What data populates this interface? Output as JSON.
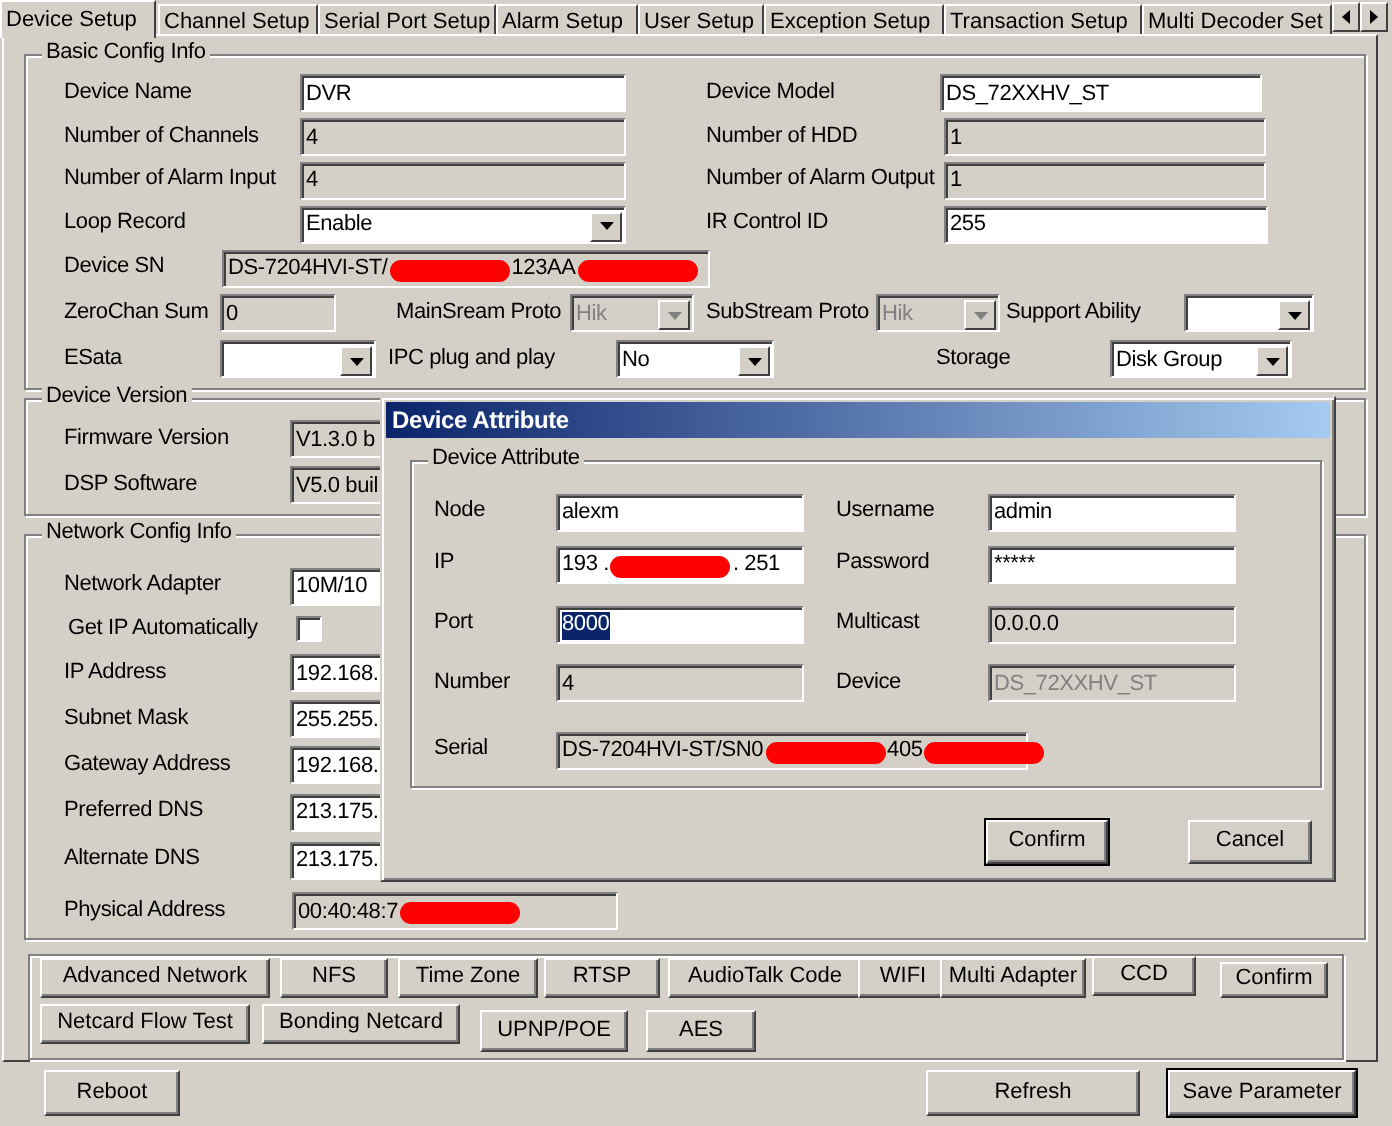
{
  "tabs": [
    {
      "label": "Device Setup",
      "selected": true
    },
    {
      "label": "Channel Setup",
      "selected": false
    },
    {
      "label": "Serial Port Setup",
      "selected": false
    },
    {
      "label": "Alarm Setup",
      "selected": false
    },
    {
      "label": "User Setup",
      "selected": false
    },
    {
      "label": "Exception Setup",
      "selected": false
    },
    {
      "label": "Transaction Setup",
      "selected": false
    },
    {
      "label": "Multi Decoder Set",
      "selected": false
    }
  ],
  "basic_config": {
    "title": "Basic Config Info",
    "fields": [
      {
        "label": "Device Name",
        "kind": "text",
        "value": "DVR"
      },
      {
        "label": "Device Model",
        "kind": "text",
        "value": "DS_72XXHV_ST"
      },
      {
        "label": "Number of Channels",
        "kind": "readonly",
        "value": "4"
      },
      {
        "label": "Number of HDD",
        "kind": "readonly",
        "value": "1"
      },
      {
        "label": "Number of Alarm Input",
        "kind": "readonly",
        "value": "4"
      },
      {
        "label": "Number of Alarm Output",
        "kind": "readonly",
        "value": "1"
      },
      {
        "label": "Loop Record",
        "kind": "select",
        "value": "Enable"
      },
      {
        "label": "IR Control ID",
        "kind": "text",
        "value": "255"
      },
      {
        "label": "Device SN",
        "kind": "readonly",
        "parts": [
          {
            "kind": "text",
            "text": "DS-7204HVI-ST/"
          },
          {
            "kind": "redaction"
          },
          {
            "kind": "text",
            "text": "123AA"
          },
          {
            "kind": "redaction"
          }
        ]
      },
      {
        "label": "ZeroChan Sum",
        "kind": "readonly",
        "value": "0"
      },
      {
        "label": "MainSream Proto",
        "kind": "select",
        "value": "Hik",
        "disabled": true
      },
      {
        "label": "SubStream Proto",
        "kind": "select",
        "value": "Hik",
        "disabled": true
      },
      {
        "label": "Support Ability",
        "kind": "select"
      },
      {
        "label": "ESata",
        "kind": "select"
      },
      {
        "label": "IPC plug and play",
        "kind": "select",
        "value": "No"
      },
      {
        "label": "Storage",
        "kind": "select",
        "value": "Disk Group"
      }
    ]
  },
  "device_version": {
    "title": "Device Version",
    "fields": [
      {
        "label": "Firmware Version",
        "kind": "readonly",
        "value": "V1.3.0 b"
      },
      {
        "label": "DSP Software",
        "kind": "readonly",
        "value": "V5.0 buil"
      }
    ]
  },
  "network_config": {
    "title": "Network Config Info",
    "fields": [
      {
        "label": "Network Adapter",
        "kind": "select",
        "value": "10M/10"
      },
      {
        "label": "Get IP Automatically",
        "kind": "checkbox",
        "checked": false
      },
      {
        "label": "IP Address",
        "kind": "text",
        "value": "192.168."
      },
      {
        "label": "Subnet Mask",
        "kind": "text",
        "value": "255.255."
      },
      {
        "label": "Gateway Address",
        "kind": "text",
        "value": "192.168."
      },
      {
        "label": "Preferred DNS",
        "kind": "text",
        "value": "213.175."
      },
      {
        "label": "Alternate DNS",
        "kind": "text",
        "value": "213.175."
      },
      {
        "label": "Physical Address",
        "kind": "readonly",
        "parts": [
          {
            "kind": "text",
            "text": "00:40:48:7"
          },
          {
            "kind": "redaction"
          }
        ]
      }
    ]
  },
  "function_buttons": [
    [
      "Advanced Network",
      "NFS",
      "Time Zone",
      "RTSP",
      "AudioTalk Code",
      "WIFI",
      "Multi Adapter",
      "CCD",
      "Confirm"
    ],
    [
      "Netcard Flow Test",
      "Bonding Netcard",
      "UPNP/POE",
      "AES"
    ]
  ],
  "bottom_buttons": [
    {
      "label": "Reboot",
      "default": false
    },
    {
      "label": "Refresh",
      "default": false
    },
    {
      "label": "Save Parameter",
      "default": true
    }
  ],
  "dialog": {
    "title": "Device Attribute",
    "group_title": "Device Attribute",
    "fields": [
      {
        "label": "Node",
        "kind": "text",
        "value": "alexm"
      },
      {
        "label": "Username",
        "kind": "text",
        "value": "admin"
      },
      {
        "label": "IP",
        "kind": "text",
        "parts": [
          {
            "kind": "text",
            "text": "193 ."
          },
          {
            "kind": "redaction"
          },
          {
            "kind": "text",
            "text": ". 251"
          }
        ]
      },
      {
        "label": "Password",
        "kind": "text",
        "value": "*****"
      },
      {
        "label": "Port",
        "kind": "text",
        "value": "8000",
        "highlighted": true
      },
      {
        "label": "Multicast",
        "kind": "readonly",
        "value": "0.0.0.0"
      },
      {
        "label": "Number",
        "kind": "readonly",
        "value": "4"
      },
      {
        "label": "Device",
        "kind": "readonly",
        "value": "DS_72XXHV_ST",
        "disabled": true
      },
      {
        "label": "Serial",
        "kind": "readonly",
        "parts": [
          {
            "kind": "text",
            "text": "DS-7204HVI-ST/SN0"
          },
          {
            "kind": "redaction"
          },
          {
            "kind": "text",
            "text": "405"
          },
          {
            "kind": "redaction"
          }
        ]
      }
    ],
    "buttons": [
      {
        "label": "Confirm",
        "default": true
      },
      {
        "label": "Cancel",
        "default": false
      }
    ]
  }
}
